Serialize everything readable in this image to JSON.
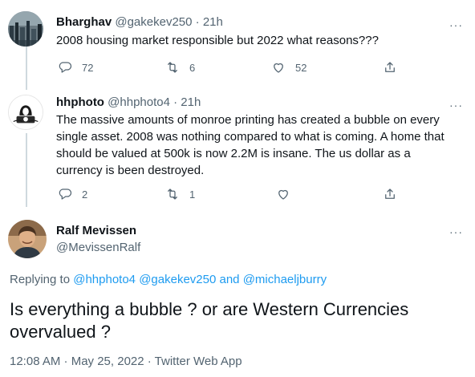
{
  "tweets": [
    {
      "name": "Bharghav",
      "handle": "@gakekev250",
      "separator": "·",
      "time": "21h",
      "text": "2008 housing market responsible but 2022 what reasons???",
      "replies": "72",
      "retweets": "6",
      "likes": "52"
    },
    {
      "name": "hhphoto",
      "handle": "@hhphoto4",
      "separator": "·",
      "time": "21h",
      "text": "The massive amounts of monroe  printing has created a bubble on every single asset. 2008 was nothing compared to what is coming. A home that should be valued at 500k is now 2.2M is insane. The us dollar as a currency is been destroyed.",
      "replies": "2",
      "retweets": "1",
      "likes": ""
    }
  ],
  "main_tweet": {
    "name": "Ralf Mevissen",
    "handle": "@MevissenRalf",
    "replying_prefix": "Replying to",
    "replying_handle_1": "@hhphoto4",
    "replying_handle_2": "@gakekev250",
    "replying_and": "and",
    "replying_handle_3": "@michaeljburry",
    "text": "Is everything a bubble ? or are Western Currencies overvalued ?",
    "timestamp": "12:08 AM · May 25, 2022 · Twitter Web App"
  },
  "more_label": "···",
  "icons": [
    "reply-icon",
    "retweet-icon",
    "like-icon",
    "share-icon",
    "more-icon"
  ],
  "colors": {
    "link": "#1d9bf0",
    "meta": "#536471",
    "text": "#0f1419",
    "thread_line": "#cfd9de"
  }
}
